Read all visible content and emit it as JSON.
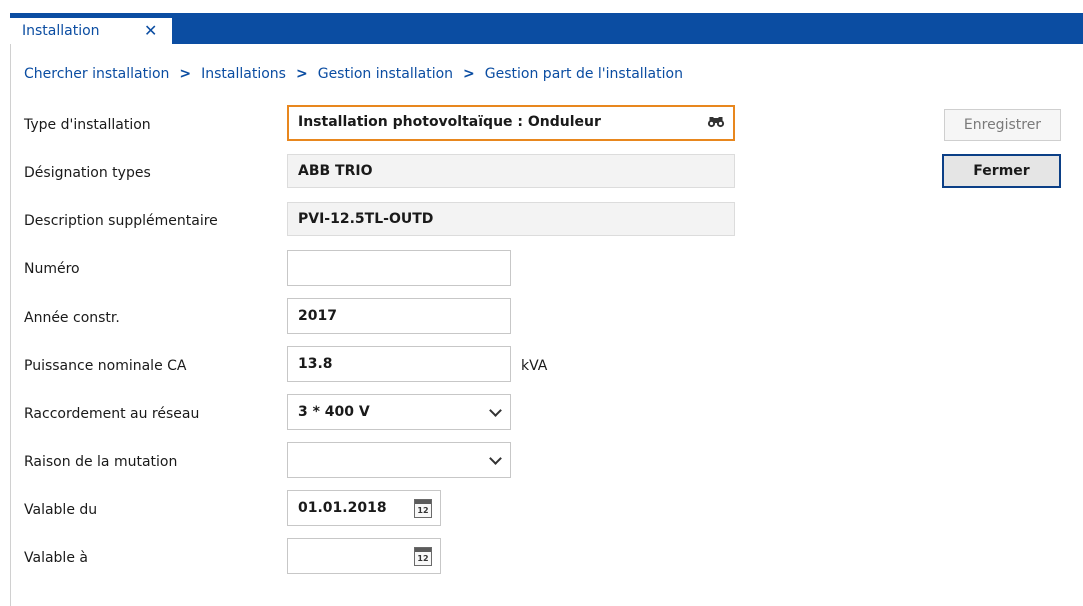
{
  "tab": {
    "label": "Installation",
    "close": "✕"
  },
  "breadcrumb": [
    "Chercher installation",
    "Installations",
    "Gestion installation",
    "Gestion part de l'installation"
  ],
  "breadcrumb_sep": ">",
  "form": {
    "type": {
      "label": "Type d'installation",
      "value": "Installation photovoltaïque : Onduleur"
    },
    "designation": {
      "label": "Désignation types",
      "value": "ABB TRIO"
    },
    "description": {
      "label": "Description supplémentaire",
      "value": "PVI-12.5TL-OUTD"
    },
    "numero": {
      "label": "Numéro",
      "value": ""
    },
    "annee": {
      "label": "Année constr.",
      "value": "2017"
    },
    "puissance": {
      "label": "Puissance nominale CA",
      "value": "13.8",
      "unit": "kVA"
    },
    "raccordement": {
      "label": "Raccordement au réseau",
      "value": "3 * 400 V"
    },
    "raison": {
      "label": "Raison de la mutation",
      "value": ""
    },
    "valable_du": {
      "label": "Valable du",
      "value": "01.01.2018"
    },
    "valable_a": {
      "label": "Valable à",
      "value": ""
    }
  },
  "calendar_icon_text": "12",
  "buttons": {
    "save": "Enregistrer",
    "close": "Fermer"
  },
  "icons": {
    "search": "binoculars-icon",
    "dropdown": "chevron-down-icon",
    "calendar": "calendar-icon"
  },
  "colors": {
    "accent": "#0b4da2",
    "focus": "#e8871e"
  }
}
